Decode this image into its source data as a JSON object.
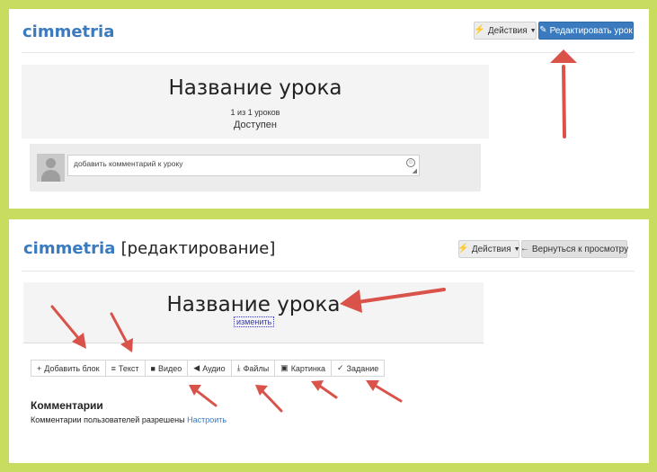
{
  "view_panel": {
    "brand": "cimmetria",
    "actions_label": "Действия",
    "edit_label": "Редактировать урок",
    "lesson_title": "Название урока",
    "lesson_count": "1 из 1 уроков",
    "status": "Доступен",
    "comment_placeholder": "добавить комментарий к уроку"
  },
  "edit_panel": {
    "brand": "cimmetria",
    "mode_suffix": "[редактирование]",
    "actions_label": "Действия",
    "back_label": "Вернуться к просмотру",
    "lesson_title": "Название урока",
    "change_link": "изменить",
    "toolbar": [
      {
        "icon": "plus-icon",
        "glyph": "+",
        "label": "Добавить блок"
      },
      {
        "icon": "text-icon",
        "glyph": "≡",
        "label": "Текст"
      },
      {
        "icon": "video-icon",
        "glyph": "■",
        "label": "Видео"
      },
      {
        "icon": "audio-icon",
        "glyph": "◀",
        "label": "Аудио"
      },
      {
        "icon": "download-icon",
        "glyph": "⤓",
        "label": "Файлы"
      },
      {
        "icon": "image-icon",
        "glyph": "▣",
        "label": "Картинка"
      },
      {
        "icon": "check-icon",
        "glyph": "✓",
        "label": "Задание"
      }
    ],
    "comments_heading": "Комментарии",
    "comments_text": "Комментарии пользователей разрешены",
    "comments_link": "Настроить"
  },
  "colors": {
    "background": "#c8dd5f",
    "brand": "#3a7bbf",
    "primary_button": "#3a7bbf",
    "arrow": "#d9534a"
  }
}
